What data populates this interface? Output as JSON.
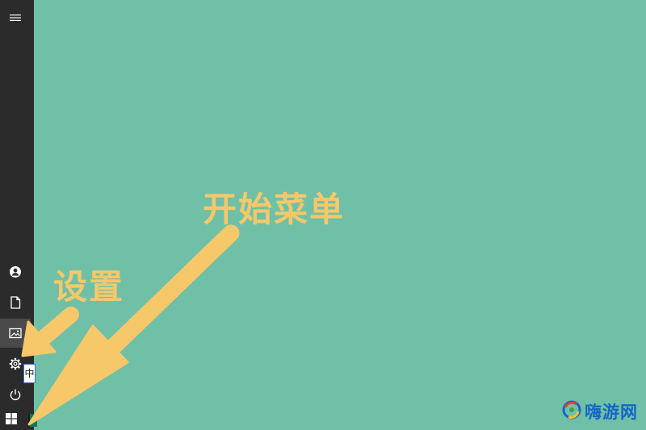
{
  "sidebar": {
    "items": [
      {
        "id": "menu",
        "icon": "hamburger-menu-icon"
      },
      {
        "id": "user",
        "icon": "user-account-icon"
      },
      {
        "id": "documents",
        "icon": "document-icon"
      },
      {
        "id": "pictures",
        "icon": "pictures-icon",
        "active": true
      },
      {
        "id": "settings",
        "icon": "gear-icon"
      },
      {
        "id": "power",
        "icon": "power-icon"
      }
    ]
  },
  "taskbar": {
    "start_icon": "windows-logo-icon",
    "ime_indicator": "中"
  },
  "annotations": {
    "start_menu_label": "开始菜单",
    "settings_label": "设置",
    "color": "#f7c86a"
  },
  "watermark": {
    "text": "嗨游网",
    "color": "#1565c8"
  },
  "colors": {
    "desktop": "#70c0a8",
    "sidebar": "#2b2b2b",
    "active_item": "#4a4a4a"
  }
}
